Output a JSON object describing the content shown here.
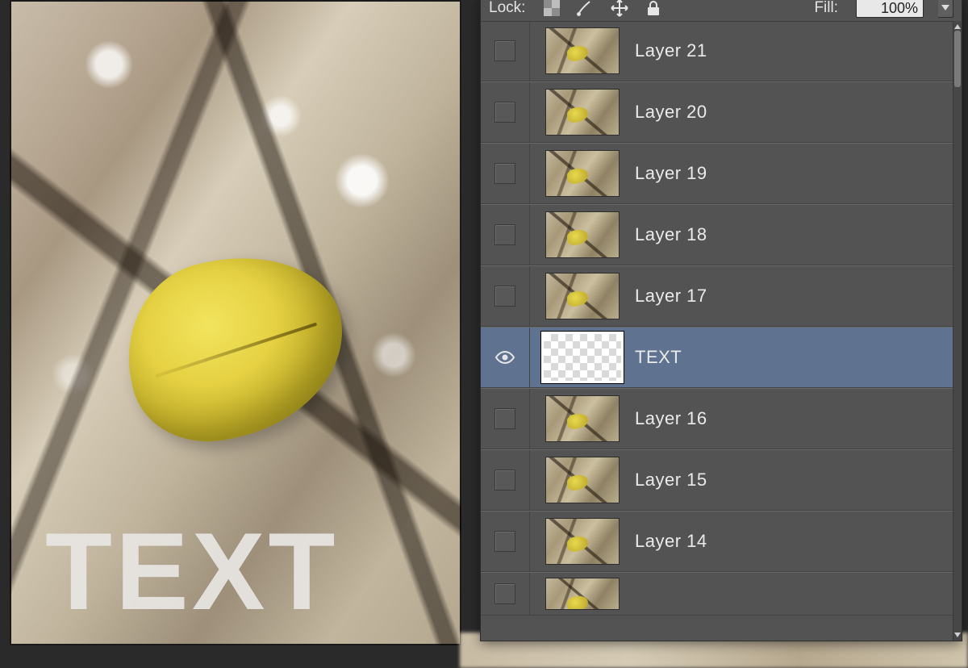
{
  "canvas": {
    "overlay_text": "TEXT"
  },
  "panel": {
    "lock_label": "Lock:",
    "fill_label": "Fill:",
    "fill_value": "100%",
    "lock_icons": [
      "transparency-icon",
      "brush-icon",
      "move-icon",
      "lock-icon"
    ],
    "layers": [
      {
        "name": "Layer 21",
        "visible": false,
        "selected": false,
        "thumb": "photo"
      },
      {
        "name": "Layer 20",
        "visible": false,
        "selected": false,
        "thumb": "photo"
      },
      {
        "name": "Layer 19",
        "visible": false,
        "selected": false,
        "thumb": "photo"
      },
      {
        "name": "Layer 18",
        "visible": false,
        "selected": false,
        "thumb": "photo"
      },
      {
        "name": "Layer 17",
        "visible": false,
        "selected": false,
        "thumb": "photo"
      },
      {
        "name": "TEXT",
        "visible": true,
        "selected": true,
        "thumb": "transparent"
      },
      {
        "name": "Layer 16",
        "visible": false,
        "selected": false,
        "thumb": "photo"
      },
      {
        "name": "Layer 15",
        "visible": false,
        "selected": false,
        "thumb": "photo"
      },
      {
        "name": "Layer 14",
        "visible": false,
        "selected": false,
        "thumb": "photo"
      },
      {
        "name": "",
        "visible": false,
        "selected": false,
        "thumb": "photo",
        "partial": true
      }
    ]
  }
}
